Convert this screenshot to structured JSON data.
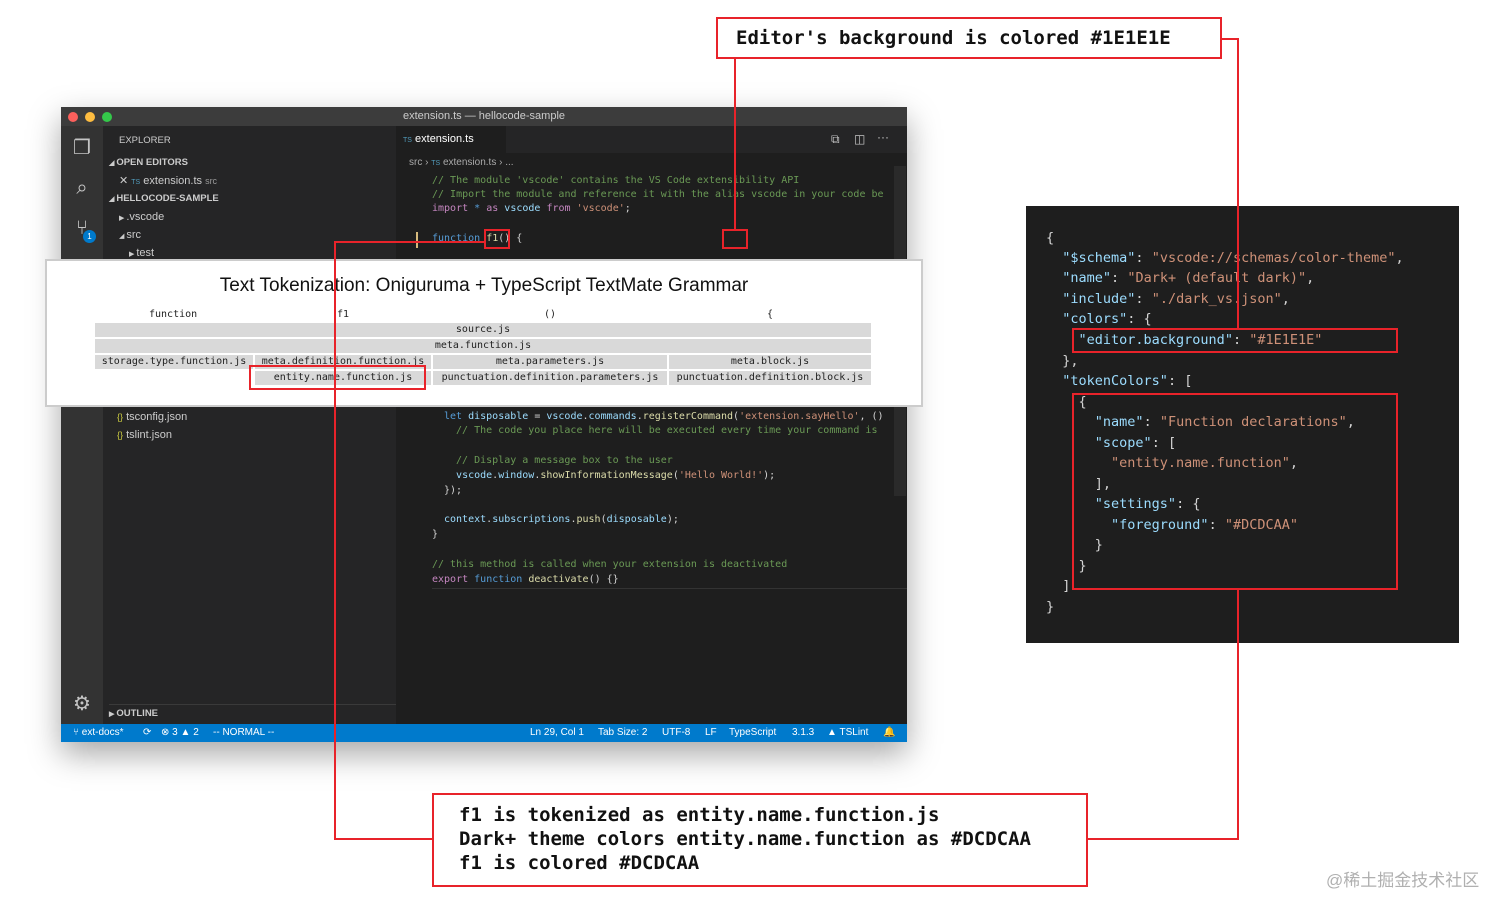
{
  "window": {
    "title": "extension.ts — hellocode-sample",
    "explorer_label": "EXPLORER",
    "open_editors_label": "OPEN EDITORS",
    "open_file": "extension.ts",
    "open_file_dir": "src",
    "project_label": "HELLOCODE-SAMPLE",
    "tree": [
      ".vscode",
      "src",
      "test",
      "tsconfig.json",
      "tslint.json"
    ],
    "outline_label": "OUTLINE",
    "scm_badge": "1",
    "tab_label": "extension.ts",
    "tab_lang": "TS",
    "breadcrumb": [
      "src",
      "extension.ts",
      "..."
    ]
  },
  "code_top": [
    "// The module 'vscode' contains the VS Code extensibility API",
    "// Import the module and reference it with the alias vscode in your code be",
    "import * as vscode from 'vscode';",
    "function f1() {"
  ],
  "code_bottom": [
    "let disposable = vscode.commands.registerCommand('extension.sayHello', ()",
    "  // The code you place here will be executed every time your command is",
    "",
    "  // Display a message box to the user",
    "  vscode.window.showInformationMessage('Hello World!');",
    "});",
    "",
    "context.subscriptions.push(disposable);",
    "}",
    "",
    "// this method is called when your extension is deactivated",
    "export function deactivate() {}"
  ],
  "statusbar": {
    "branch": "ext-docs*",
    "errors": "3",
    "warnings": "2",
    "mode": "-- NORMAL --",
    "position": "Ln 29, Col 1",
    "tab_size": "Tab Size: 2",
    "encoding": "UTF-8",
    "eol": "LF",
    "language": "TypeScript",
    "version": "3.1.3",
    "linter": "TSLint"
  },
  "tokenization": {
    "title": "Text Tokenization: Oniguruma + TypeScript TextMate Grammar",
    "tokens": [
      "function",
      "f1",
      "()",
      "{"
    ],
    "scopes": {
      "source": "source.js",
      "meta_function": "meta.function.js",
      "storage": "storage.type.function.js",
      "meta_def": "meta.definition.function.js",
      "meta_params": "meta.parameters.js",
      "meta_block": "meta.block.js",
      "entity": "entity.name.function.js",
      "punct_params": "punctuation.definition.parameters.js",
      "punct_block": "punctuation.definition.block.js"
    }
  },
  "theme_json": {
    "lines": [
      "{",
      "  \"$schema\": \"vscode://schemas/color-theme\",",
      "  \"name\": \"Dark+ (default dark)\",",
      "  \"include\": \"./dark_vs.json\",",
      "  \"colors\": {",
      "    \"editor.background\": \"#1E1E1E\"",
      "  },",
      "  \"tokenColors\": [",
      "    {",
      "      \"name\": \"Function declarations\",",
      "      \"scope\": [",
      "        \"entity.name.function\",",
      "      ],",
      "      \"settings\": {",
      "        \"foreground\": \"#DCDCAA\"",
      "      }",
      "    }",
      "  ]",
      "}"
    ]
  },
  "callouts": {
    "top": "Editor's background is colored #1E1E1E",
    "bottom": [
      "f1 is tokenized as entity.name.function.js",
      "Dark+ theme colors entity.name.function as #DCDCAA",
      "f1 is colored #DCDCAA"
    ]
  },
  "watermark": "@稀土掘金技术社区",
  "colors": {
    "highlight": "#e8232a",
    "editor_bg": "#1E1E1E",
    "function_fg": "#DCDCAA",
    "statusbar": "#007acc"
  }
}
